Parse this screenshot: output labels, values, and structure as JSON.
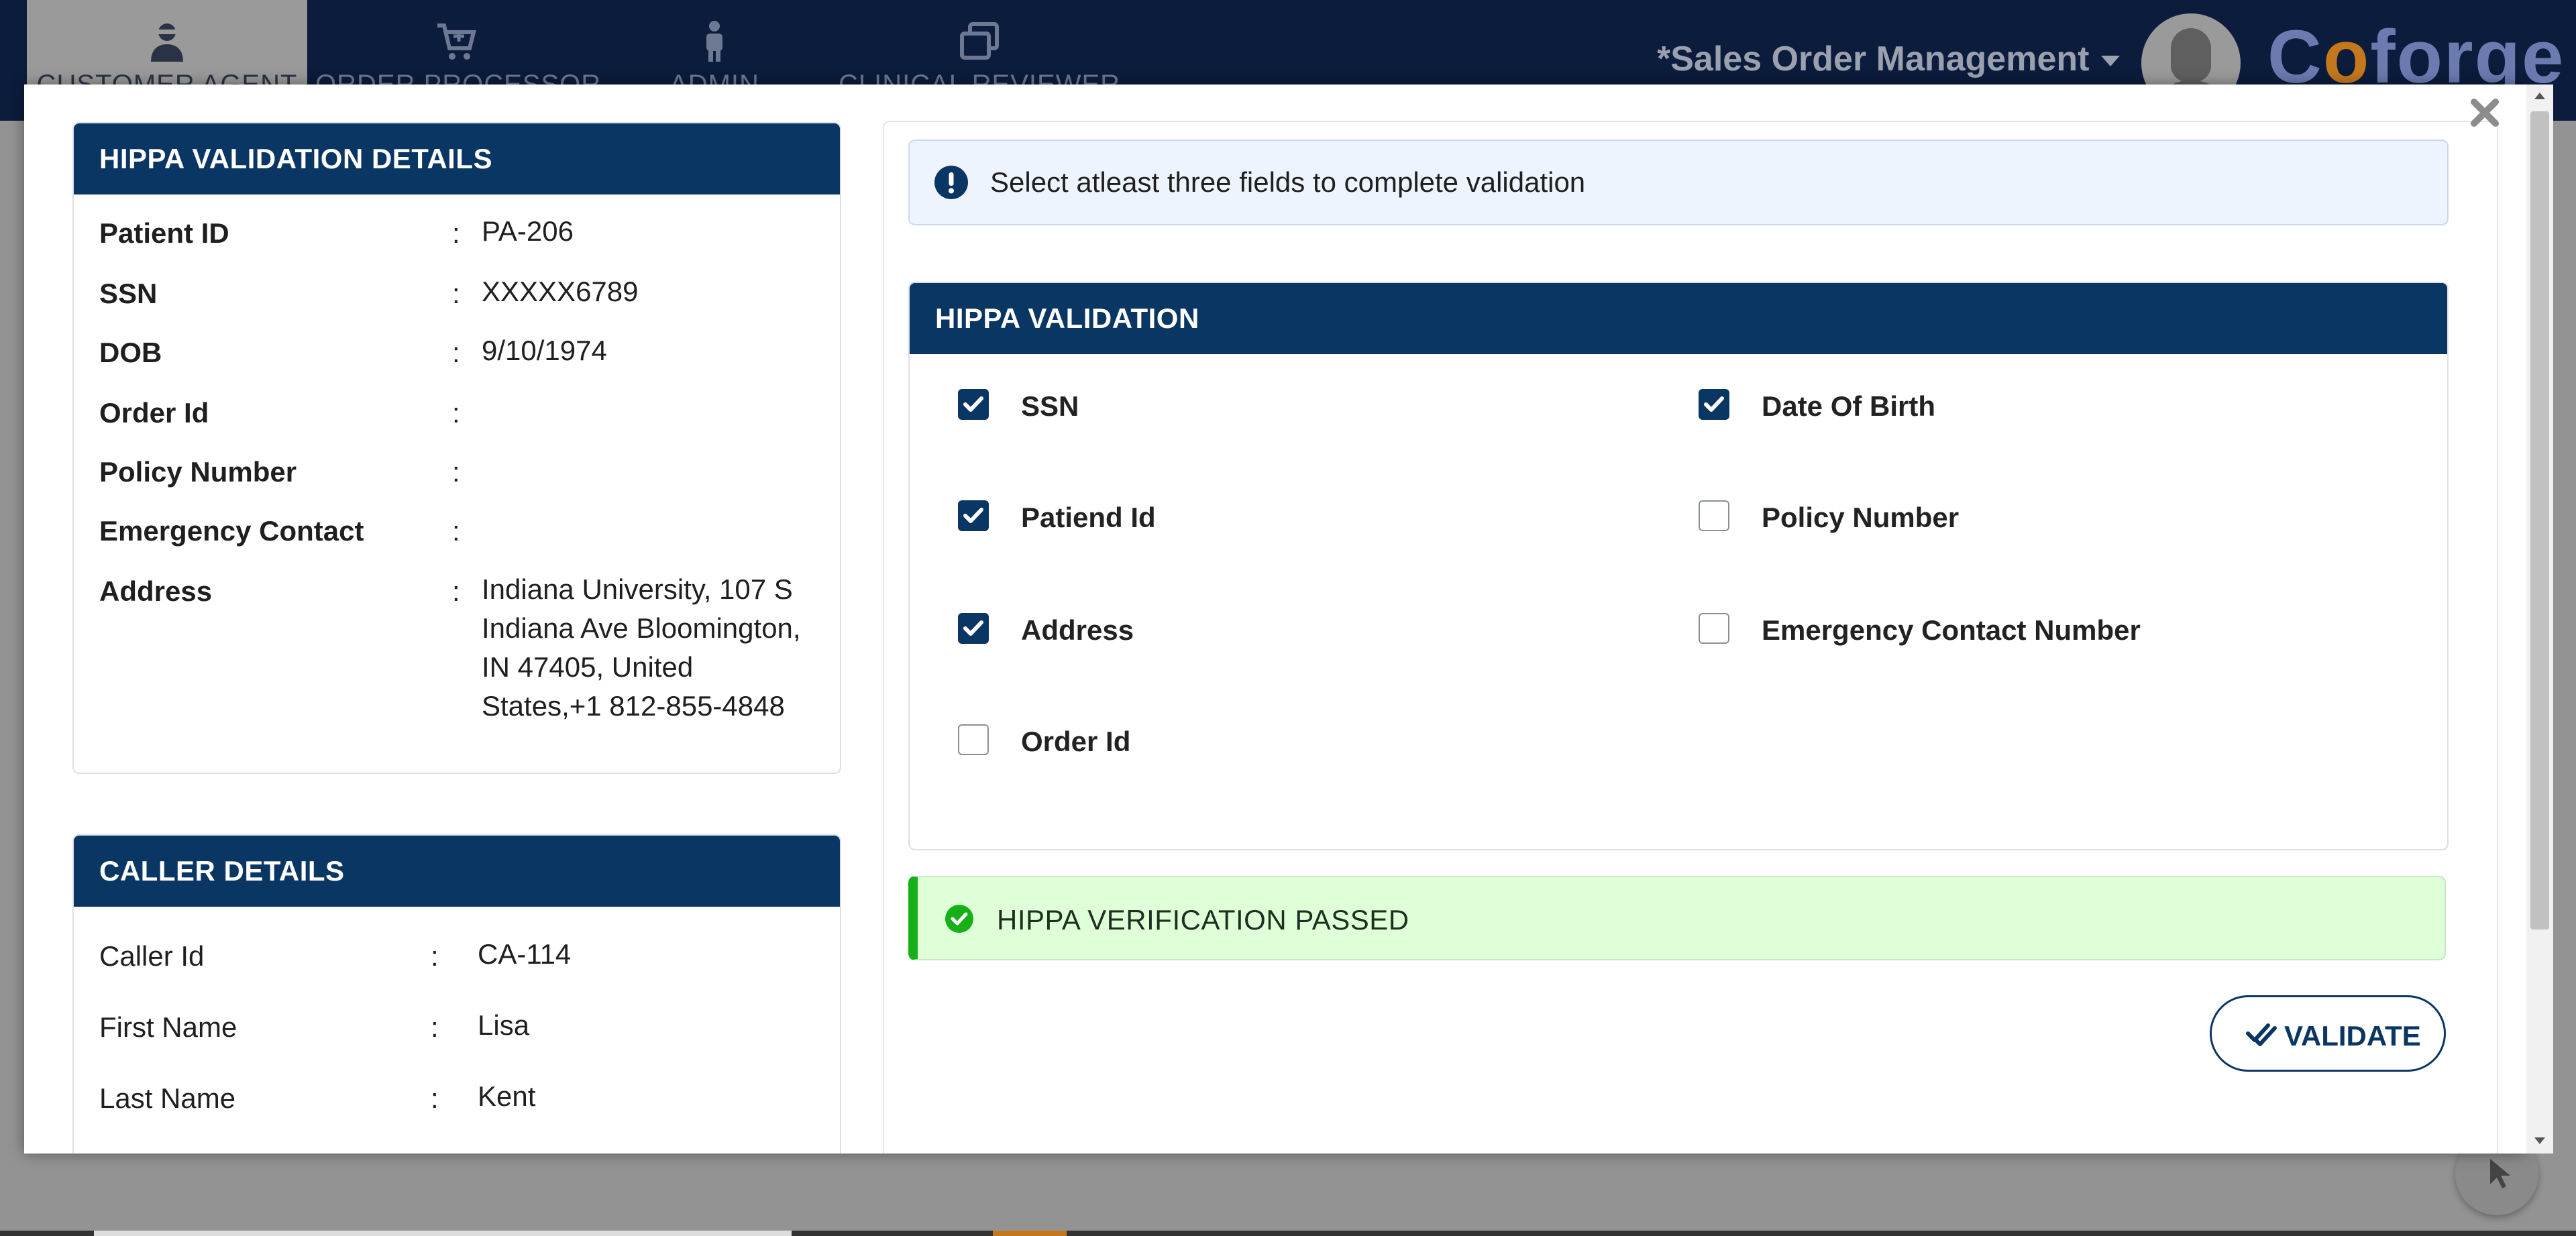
{
  "nav": {
    "tabs": [
      {
        "label": "CUSTOMER AGENT",
        "icon": "agent-icon",
        "active": true
      },
      {
        "label": "ORDER PROCESSOR",
        "icon": "cart-icon",
        "active": false
      },
      {
        "label": "ADMIN",
        "icon": "person-icon",
        "active": false
      },
      {
        "label": "CLINICAL REVIEWER",
        "icon": "copy-icon",
        "active": false
      }
    ],
    "app_title": "*Sales Order Management",
    "logo_text": "Coforge"
  },
  "hippa_details": {
    "title": "HIPPA VALIDATION DETAILS",
    "separator": ":",
    "rows": [
      {
        "label": "Patient ID",
        "value": "PA-206"
      },
      {
        "label": "SSN",
        "value": "XXXXX6789"
      },
      {
        "label": "DOB",
        "value": "9/10/1974"
      },
      {
        "label": "Order Id",
        "value": ""
      },
      {
        "label": "Policy Number",
        "value": ""
      },
      {
        "label": "Emergency Contact",
        "value": ""
      },
      {
        "label": "Address",
        "value": "Indiana University, 107 S Indiana Ave Bloomington, IN 47405, United States,+1 812-855-4848"
      }
    ]
  },
  "caller_details": {
    "title": "CALLER DETAILS",
    "separator": ":",
    "rows": [
      {
        "label": "Caller Id",
        "value": "CA-114"
      },
      {
        "label": "First Name",
        "value": "Lisa"
      },
      {
        "label": "Last Name",
        "value": "Kent"
      }
    ]
  },
  "info_message": "Select atleast three fields to complete validation",
  "validation": {
    "title": "HIPPA VALIDATION",
    "fields": [
      {
        "label": "SSN",
        "checked": true
      },
      {
        "label": "Date Of Birth",
        "checked": true
      },
      {
        "label": "Patiend Id",
        "checked": true
      },
      {
        "label": "Policy Number",
        "checked": false
      },
      {
        "label": "Address",
        "checked": true
      },
      {
        "label": "Emergency Contact Number",
        "checked": false
      },
      {
        "label": "Order Id",
        "checked": false
      }
    ]
  },
  "success_message": "HIPPA VERIFICATION PASSED",
  "validate_label": "VALIDATE",
  "colors": {
    "nav_bg": "#0b1c3c",
    "header_blue": "#0a3663",
    "success_green": "#18b018",
    "success_bg": "#dfffd9",
    "info_bg": "#eef4fd",
    "logo_orange": "#c4781e"
  }
}
